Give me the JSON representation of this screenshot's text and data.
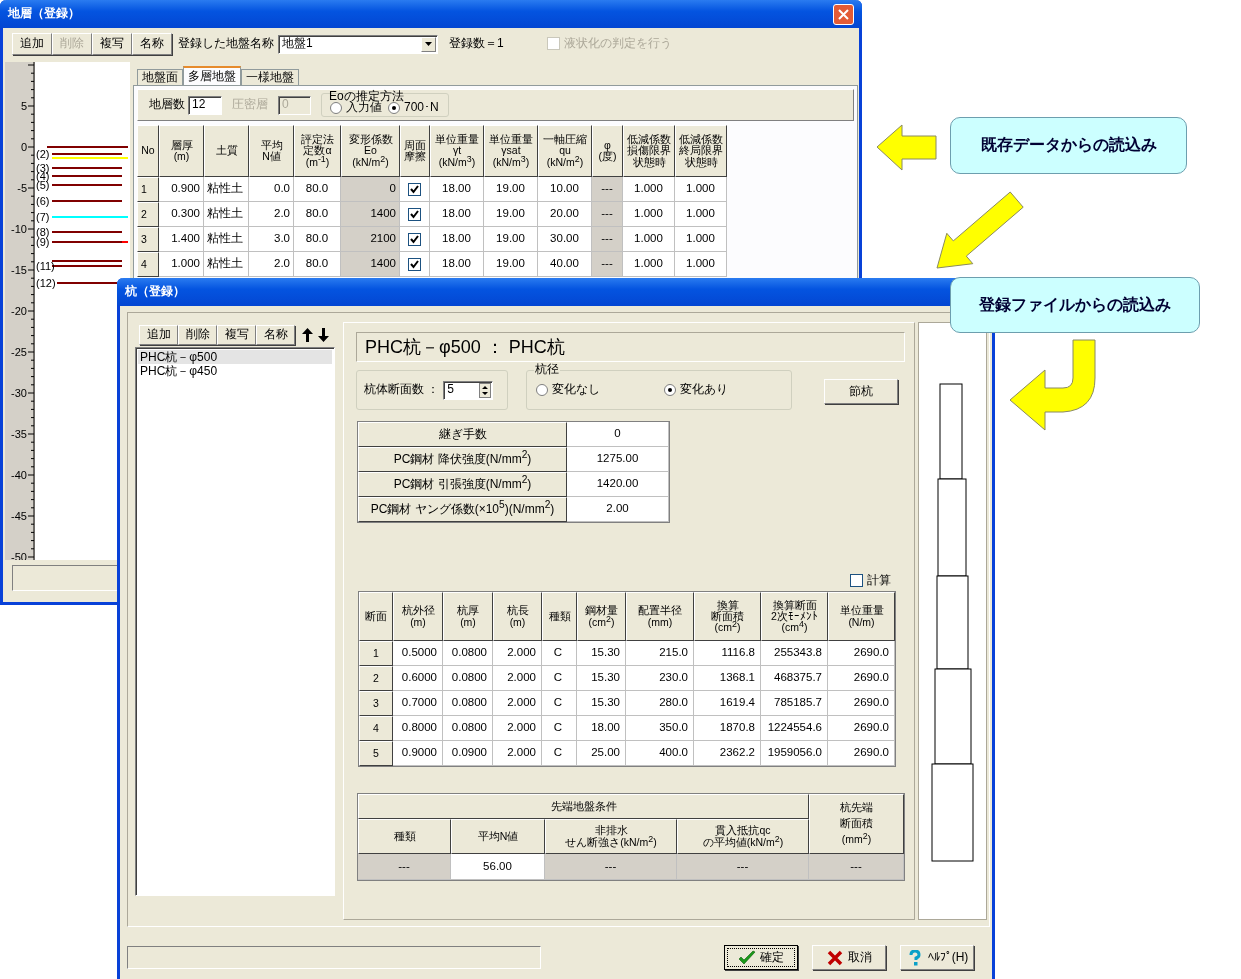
{
  "back_window": {
    "title": "地層（登録）",
    "toolbar": {
      "buttons": [
        {
          "label": "追加",
          "disabled": false
        },
        {
          "label": "削除",
          "disabled": true
        },
        {
          "label": "複写",
          "disabled": false
        },
        {
          "label": "名称",
          "disabled": false
        }
      ],
      "name_label": "登録した地盤名称",
      "name_value": "地盤1",
      "count": "登録数＝1",
      "liquefaction": {
        "label": "液状化の判定を行う",
        "checked": false,
        "disabled": true
      }
    },
    "depth_scale": [
      "5",
      "0",
      "-5",
      "-10",
      "-15",
      "-20",
      "-25",
      "-30",
      "-35",
      "-40",
      "-45",
      "-50"
    ],
    "layer_labels": [
      "(2)",
      "(3)",
      "(4)",
      "(5)",
      "(6)",
      "(7)",
      "(8)",
      "(9)",
      "(11)",
      "(12)"
    ],
    "tabs": [
      {
        "label": "地盤面",
        "selected": false
      },
      {
        "label": "多層地盤",
        "selected": true
      },
      {
        "label": "一様地盤",
        "selected": false
      }
    ],
    "layer_count": {
      "label": "地層数",
      "value": "12"
    },
    "consolidation": {
      "label": "圧密層",
      "value": "0",
      "disabled": true
    },
    "eo_method": {
      "title": "Eoの推定方法",
      "options": [
        {
          "label": "入力値",
          "selected": false
        },
        {
          "label": "700･N",
          "selected": true
        }
      ]
    },
    "table": {
      "columns": [
        {
          "label": "No",
          "kind": "text"
        },
        {
          "label": "層厚\n(m)",
          "kind": "text"
        },
        {
          "label": "土質",
          "kind": "text"
        },
        {
          "label": "平均\nN値",
          "kind": "text"
        },
        {
          "label": [
            "評定法",
            "定数α",
            "(m$^{-1}$)"
          ],
          "kind": "text"
        },
        {
          "label": "変形係数\nEo\n(kN/m$^{2}$)",
          "kind": "shaded"
        },
        {
          "label": [
            "周面",
            "摩擦"
          ],
          "kind": "check"
        },
        {
          "label": "単位重量\nγt\n(kN/m$^{3}$)",
          "kind": "text"
        },
        {
          "label": "単位重量\nγsat\n(kN/m$^{3}$)",
          "kind": "text"
        },
        {
          "label": "一軸圧縮\nqu\n(kN/m$^{2}$)",
          "kind": "text"
        },
        {
          "label": "φ\n(度)",
          "kind": "shaded"
        },
        {
          "label": [
            "低減係数",
            "損傷限界",
            "状態時"
          ],
          "kind": "text"
        },
        {
          "label": [
            "低減係数",
            "終局限界",
            "状態時"
          ],
          "kind": "text"
        }
      ],
      "rows": [
        {
          "cells": [
            "1",
            "0.900",
            "粘性土",
            "0.0",
            "80.0",
            "0",
            {
              "checked": true
            },
            "18.00",
            "19.00",
            "10.00",
            "---",
            "1.000",
            "1.000"
          ]
        },
        {
          "cells": [
            "2",
            "0.300",
            "粘性土",
            "2.0",
            "80.0",
            "1400",
            {
              "checked": true
            },
            "18.00",
            "19.00",
            "20.00",
            "---",
            "1.000",
            "1.000"
          ]
        },
        {
          "cells": [
            "3",
            "1.400",
            "粘性土",
            "3.0",
            "80.0",
            "2100",
            {
              "checked": true
            },
            "18.00",
            "19.00",
            "30.00",
            "---",
            "1.000",
            "1.000"
          ]
        },
        {
          "cells": [
            "4",
            "1.000",
            "粘性土",
            "2.0",
            "80.0",
            "1400",
            {
              "checked": true
            },
            "18.00",
            "19.00",
            "40.00",
            "---",
            "1.000",
            "1.000"
          ]
        }
      ]
    }
  },
  "front_window": {
    "title": "杭（登録）",
    "list_toolbar": [
      "追加",
      "削除",
      "複写",
      "名称"
    ],
    "piles": [
      {
        "label": "PHC杭－φ500",
        "selected": true
      },
      {
        "label": "PHC杭－φ450",
        "selected": false
      }
    ],
    "header": "PHC杭－φ500 ： PHC杭",
    "section_count": {
      "label": "杭体断面数 ：",
      "value": "5"
    },
    "diameter": {
      "title": "杭径",
      "options": [
        {
          "label": "変化なし",
          "selected": false
        },
        {
          "label": "変化あり",
          "selected": true
        }
      ]
    },
    "joint_button": "節杭",
    "properties": [
      {
        "label": "継ぎ手数",
        "value": "0"
      },
      {
        "label": "PC鋼材  降伏強度(N/mm$^{2}$)",
        "value": "1275.00"
      },
      {
        "label": "PC鋼材  引張強度(N/mm$^{2}$)",
        "value": "1420.00"
      },
      {
        "label": "PC鋼材  ヤング係数(×10$^{5}$)(N/mm$^{2}$)",
        "value": "2.00"
      }
    ],
    "calc": {
      "label": "計算",
      "checked": false
    },
    "sections": {
      "columns": [
        "断面",
        "杭外径\n(m)",
        "杭厚\n(m)",
        "杭長\n(m)",
        "種類",
        "鋼材量\n(cm$^{2}$)",
        "配置半径\n(mm)",
        [
          "換算",
          "断面積",
          "(cm$^{2}$)"
        ],
        "換算断面\n2次ﾓｰﾒﾝﾄ\n(cm$^{4}$)",
        "単位重量\n(N/m)"
      ],
      "rows": [
        [
          "1",
          "0.5000",
          "0.0800",
          "2.000",
          "C",
          "15.30",
          "215.0",
          "1116.8",
          "255343.8",
          "2690.0"
        ],
        [
          "2",
          "0.6000",
          "0.0800",
          "2.000",
          "C",
          "15.30",
          "230.0",
          "1368.1",
          "468375.7",
          "2690.0"
        ],
        [
          "3",
          "0.7000",
          "0.0800",
          "2.000",
          "C",
          "15.30",
          "280.0",
          "1619.4",
          "785185.7",
          "2690.0"
        ],
        [
          "4",
          "0.8000",
          "0.0800",
          "2.000",
          "C",
          "18.00",
          "350.0",
          "1870.8",
          "1224554.6",
          "2690.0"
        ],
        [
          "5",
          "0.9000",
          "0.0900",
          "2.000",
          "C",
          "25.00",
          "400.0",
          "2362.2",
          "1959056.0",
          "2690.0"
        ]
      ]
    },
    "tip": {
      "group": "先端地盤条件",
      "area_header": [
        "杭先端",
        "断面積",
        "(mm$^{2}$)"
      ],
      "columns": [
        "種類",
        "平均N値",
        [
          "非排水",
          "せん断強さ(kN/m$^{2}$)"
        ],
        "貫入抵抗qc\nの平均値(kN/m$^{2}$)"
      ],
      "values": [
        {
          "text": "---",
          "editable": false
        },
        {
          "text": "56.00",
          "editable": true
        },
        {
          "text": "---",
          "editable": false
        },
        {
          "text": "---",
          "editable": false
        },
        {
          "text": "---",
          "editable": false
        }
      ]
    },
    "buttons": [
      {
        "label": "確定",
        "kind": "ok"
      },
      {
        "label": "取消",
        "kind": "cancel"
      },
      {
        "label": "ﾍﾙﾌﾟ(H)",
        "kind": "help"
      }
    ]
  },
  "callouts": [
    {
      "text": "既存データからの読込み"
    },
    {
      "text": "登録ファイルからの読込み"
    }
  ]
}
